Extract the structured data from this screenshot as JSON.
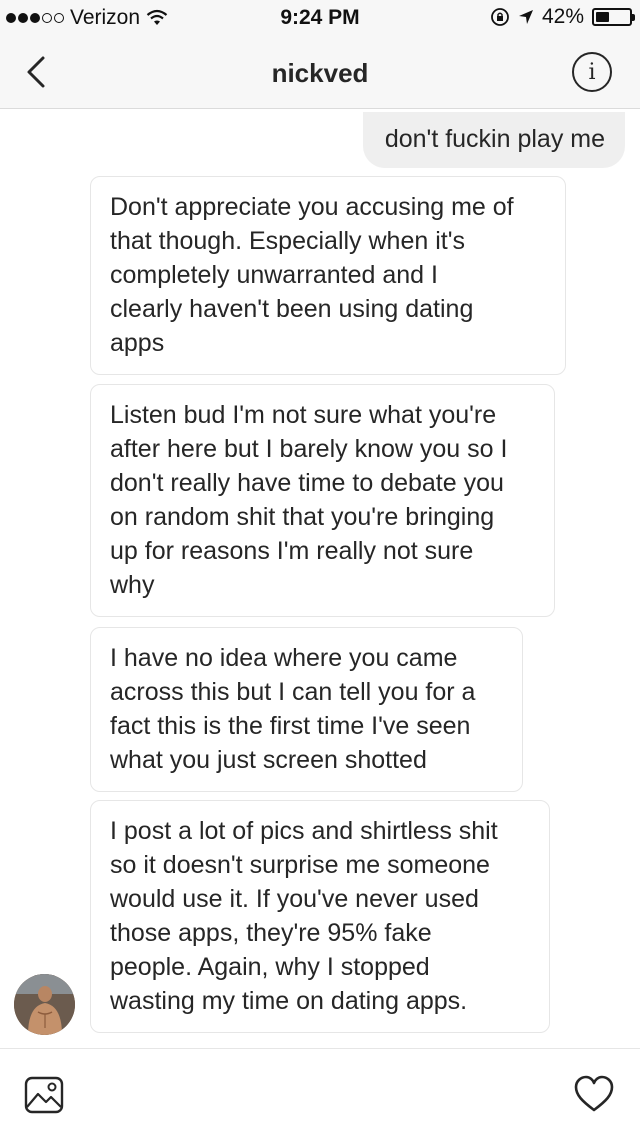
{
  "status_bar": {
    "carrier": "Verizon",
    "time": "9:24 PM",
    "battery_percent": "42%",
    "battery_level": 0.42,
    "icons": [
      "signal-dots-icon",
      "wifi-icon",
      "orientation-lock-icon",
      "location-arrow-icon",
      "battery-icon"
    ]
  },
  "header": {
    "title": "nickved",
    "back_icon": "chevron-left-icon",
    "info_label": "i"
  },
  "messages": [
    {
      "direction": "sent",
      "text": "don't fuckin play me"
    },
    {
      "direction": "received",
      "lines": [
        "Don't appreciate you accusing me of",
        "that though. Especially when it's",
        "completely unwarranted and I",
        "clearly haven't been using dating",
        "apps"
      ]
    },
    {
      "direction": "received",
      "lines": [
        "Listen bud I'm not sure what you're",
        "after here but I barely know you so I",
        "don't really have time to debate you",
        "on random shit that you're bringing",
        "up for reasons I'm really not sure",
        "why"
      ]
    },
    {
      "direction": "received",
      "lines": [
        "I have no idea where you came",
        "across this but I can tell you for a",
        "fact this is the first time I've seen",
        "what you just screen shotted"
      ]
    },
    {
      "direction": "received",
      "lines": [
        "I post a lot of pics and shirtless shit",
        "so it doesn't surprise me someone",
        "would use it. If you've never used",
        "those apps, they're 95% fake",
        "people. Again, why I stopped",
        "wasting my time on dating apps."
      ]
    }
  ],
  "composer": {
    "left_icon": "image-gallery-icon",
    "right_icon": "heart-icon"
  },
  "colors": {
    "bar_bg": "#f7f7f7",
    "sent_bubble": "#efefef",
    "received_border": "#e6e6e6",
    "text": "#262626"
  }
}
